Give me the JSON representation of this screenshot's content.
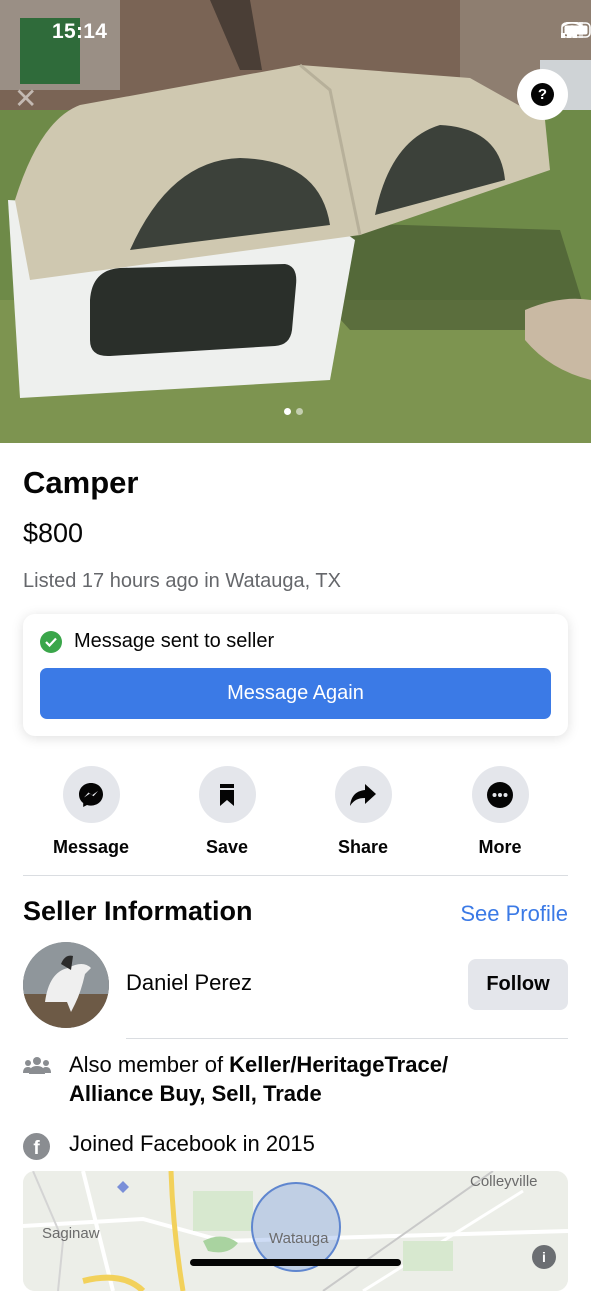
{
  "status_bar": {
    "time": "15:14"
  },
  "listing": {
    "title": "Camper",
    "price": "$800",
    "listed": "Listed 17 hours ago in Watauga, TX",
    "photo_count": 2,
    "current_photo": 1
  },
  "message_card": {
    "status": "Message sent to seller",
    "button_label": "Message Again"
  },
  "actions": [
    {
      "label": "Message",
      "icon": "messenger-icon"
    },
    {
      "label": "Save",
      "icon": "bookmark-icon"
    },
    {
      "label": "Share",
      "icon": "share-arrow-icon"
    },
    {
      "label": "More",
      "icon": "more-dots-icon"
    }
  ],
  "seller": {
    "heading": "Seller Information",
    "see_profile": "See Profile",
    "name": "Daniel Perez",
    "follow_label": "Follow",
    "member_prefix": "Also member of ",
    "member_group": "Keller/HeritageTrace/ Alliance Buy, Sell, Trade",
    "joined": "Joined Facebook in 2015"
  },
  "map": {
    "labels": {
      "colleyville": "Colleyville",
      "saginaw": "Saginaw",
      "watauga": "Watauga"
    },
    "info": "i"
  },
  "colors": {
    "accent": "#3b7ae6",
    "success": "#3aa64a",
    "button_gray": "#e4e6eb"
  }
}
